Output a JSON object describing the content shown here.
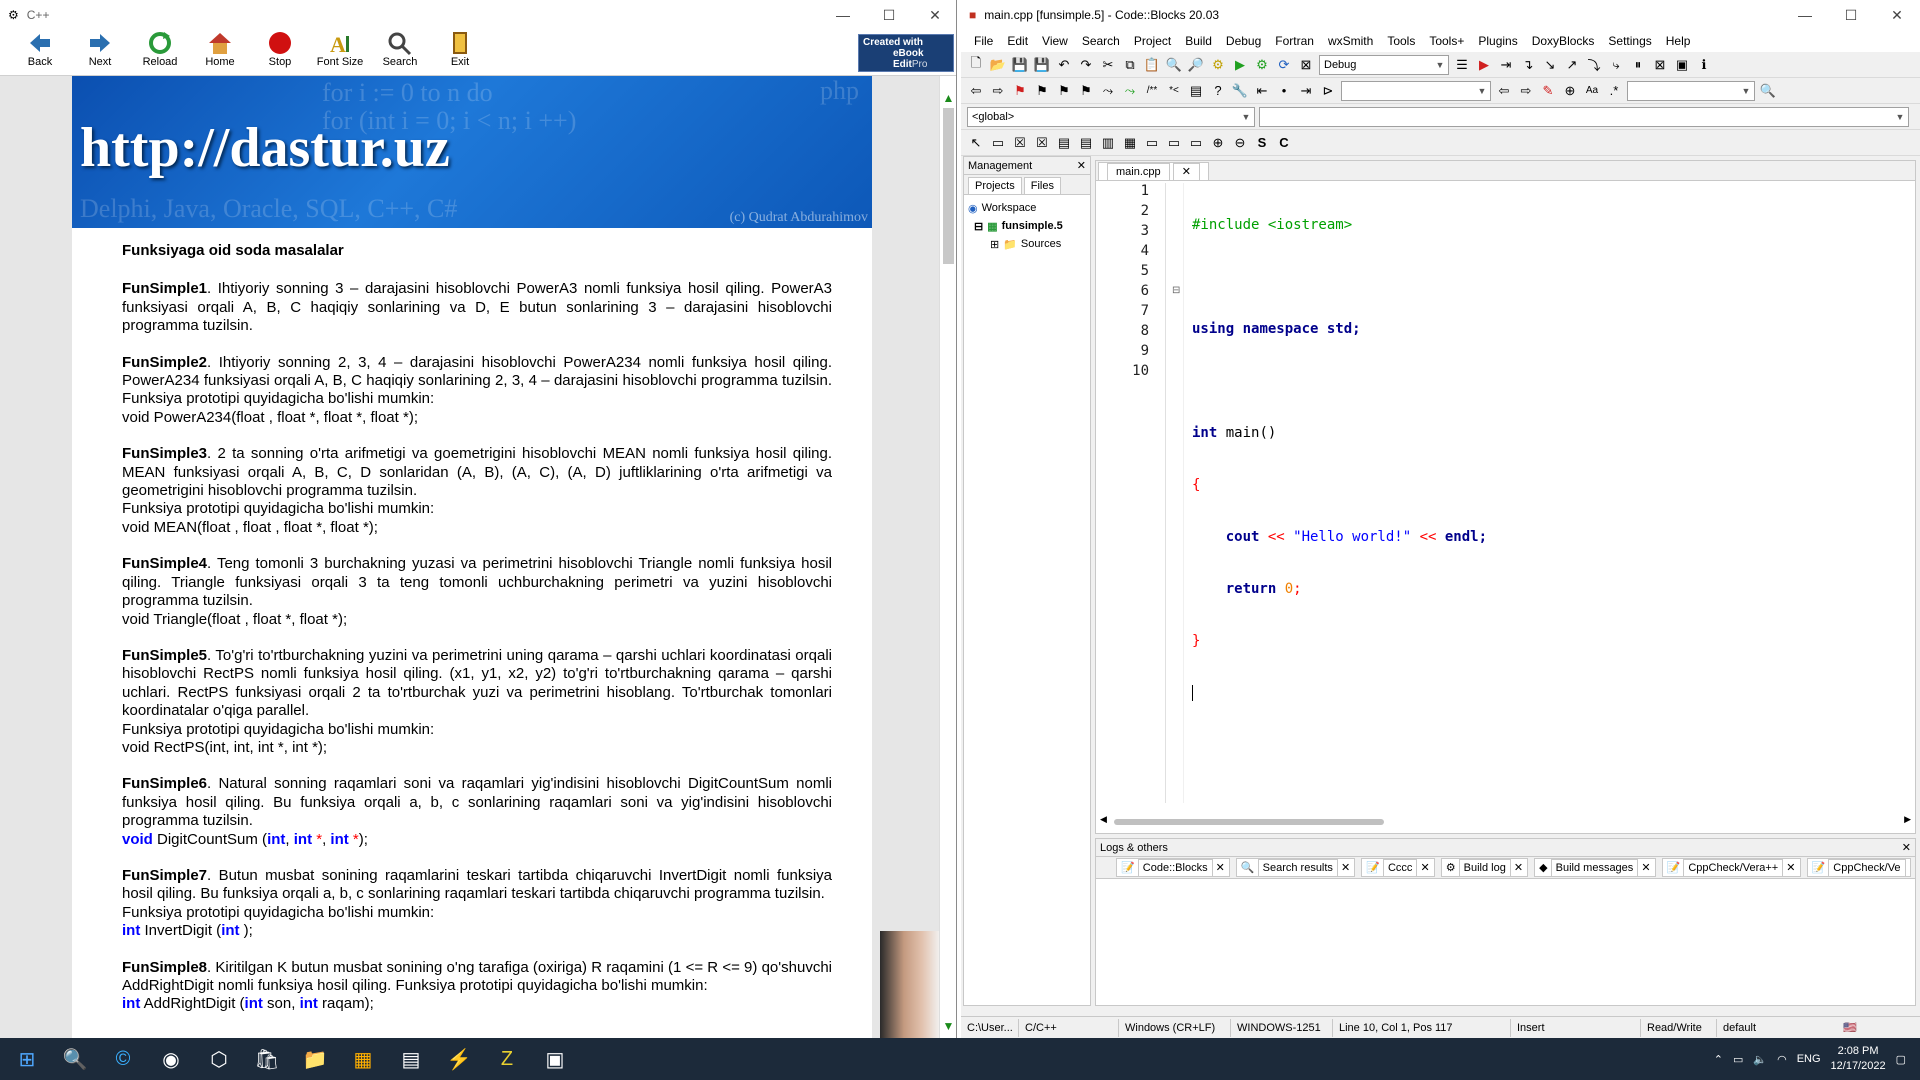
{
  "ebook": {
    "title": "C++",
    "toolbar": [
      {
        "label": "Back",
        "icon": "back-arrow-icon"
      },
      {
        "label": "Next",
        "icon": "next-arrow-icon"
      },
      {
        "label": "Reload",
        "icon": "reload-icon"
      },
      {
        "label": "Home",
        "icon": "home-icon"
      },
      {
        "label": "Stop",
        "icon": "stop-icon"
      },
      {
        "label": "Font Size",
        "icon": "font-size-icon"
      },
      {
        "label": "Search",
        "icon": "search-icon"
      },
      {
        "label": "Exit",
        "icon": "exit-icon"
      }
    ],
    "badge": {
      "line1": "Created with",
      "line2": "eBook",
      "line3": "Edit",
      "line4": "Pro"
    },
    "banner": {
      "url": "http://dastur.uz",
      "ghost1": "for  i := 0 to n do",
      "ghost2": "for  (int i = 0; i < n; i ++)",
      "ghost3": "Delphi, Java, Oracle, SQL, C++, C#",
      "ghost4": "php",
      "copyright": "(c) Qudrat Abdurahimov"
    },
    "heading": "Funksiyaga oid soda masalalar",
    "tasks": [
      {
        "name": "FunSimple1",
        "text": ". Ihtiyoriy sonning 3 – darajasini hisoblovchi PowerA3 nomli funksiya hosil qiling. PowerA3 funksiyasi orqali A, B, C haqiqiy sonlarining va D, E butun sonlarining 3 – darajasini hisoblovchi programma tuzilsin.",
        "extra": "",
        "proto": ""
      },
      {
        "name": "FunSimple2",
        "text": ". Ihtiyoriy sonning 2, 3, 4 – darajasini hisoblovchi PowerA234 nomli funksiya hosil qiling. PowerA234 funksiyasi orqali A, B, C haqiqiy sonlarining 2, 3, 4 – darajasini hisoblovchi programma tuzilsin. Funksiya prototipi quyidagicha bo'lishi mumkin:",
        "extra": "",
        "proto": "void PowerA234(float , float *, float *, float *);"
      },
      {
        "name": "FunSimple3",
        "text": ". 2 ta sonning o'rta arifmetigi va goemetrigini hisoblovchi MEAN nomli funksiya hosil qiling. MEAN funksiyasi orqali A, B, C, D sonlaridan (A, B), (A, C), (A, D) juftliklarining o'rta arifmetigi va geometrigini hisoblovchi programma tuzilsin.",
        "extra": "Funksiya prototipi quyidagicha bo'lishi mumkin:",
        "proto": "void MEAN(float , float , float *, float *);"
      },
      {
        "name": "FunSimple4",
        "text": ". Teng tomonli 3 burchakning yuzasi va perimetrini hisoblovchi Triangle nomli funksiya hosil qiling. Triangle funksiyasi orqali 3 ta teng tomonli uchburchakning perimetri va yuzini hisoblovchi programma tuzilsin.",
        "extra": "",
        "proto": "void Triangle(float ,  float *, float *);"
      },
      {
        "name": "FunSimple5",
        "text": ". To'g'ri to'rtburchakning yuzini va perimetrini uning qarama – qarshi uchlari koordinatasi orqali hisoblovchi RectPS nomli funksiya hosil qiling. (x1, y1, x2, y2) to'g'ri to'rtburchakning qarama – qarshi uchlari. RectPS funksiyasi orqali 2 ta to'rtburchak yuzi va perimetrini hisoblang. To'rtburchak tomonlari koordinatalar o'qiga parallel.",
        "extra": "Funksiya prototipi quyidagicha bo'lishi mumkin:",
        "proto": "void RectPS(int,  int,  int *, int *);"
      },
      {
        "name": "FunSimple6",
        "text": ". Natural sonning raqamlari soni va raqamlari yig'indisini hisoblovchi DigitCountSum nomli funksiya hosil qiling. Bu funksiya orqali a, b, c sonlarining raqamlari soni va yig'indisini hisoblovchi programma tuzilsin.",
        "extra": "",
        "proto": ""
      },
      {
        "name": "FunSimple7",
        "text": ". Butun musbat sonining raqamlarini teskari tartibda chiqaruvchi InvertDigit nomli funksiya hosil qiling. Bu funksiya orqali a, b, c sonlarining raqamlari teskari tartibda chiqaruvchi programma tuzilsin.",
        "extra": "Funksiya prototipi quyidagicha bo'lishi mumkin:",
        "proto": ""
      },
      {
        "name": "FunSimple8",
        "text": ". Kiritilgan K butun musbat sonining o'ng tarafiga (oxiriga)  R raqamini (1 <= R <= 9) qo'shuvchi AddRightDigit nomli funksiya hosil qiling. Funksiya prototipi quyidagicha bo'lishi mumkin:",
        "extra": "",
        "proto": ""
      }
    ],
    "proto6": {
      "kw1": "void",
      "name": " DigitCountSum (",
      "kw2": "int",
      "sep1": ",  ",
      "kw3": "int",
      "st1": " *",
      "sep2": ", ",
      "kw4": "int",
      "st2": " *",
      "end": ");"
    },
    "proto7": {
      "kw1": "int",
      "name": " InvertDigit (",
      "kw2": "int",
      "end": " );"
    },
    "proto8": {
      "kw1": "int",
      "name": " AddRightDigit (",
      "kw2": "int",
      "p1": " son, ",
      "kw3": "int",
      "end": " raqam);"
    }
  },
  "codeblocks": {
    "title": "main.cpp [funsimple.5] - Code::Blocks 20.03",
    "menu": [
      "File",
      "Edit",
      "View",
      "Search",
      "Project",
      "Build",
      "Debug",
      "Fortran",
      "wxSmith",
      "Tools",
      "Tools+",
      "Plugins",
      "DoxyBlocks",
      "Settings",
      "Help"
    ],
    "build_target": "Debug",
    "scope": "<global>",
    "management": {
      "title": "Management",
      "tab1": "Projects",
      "tab2": "Files",
      "workspace": "Workspace",
      "project": "funsimple.5",
      "sources": "Sources"
    },
    "editor_tab": "main.cpp",
    "line_numbers": [
      "1",
      "2",
      "3",
      "4",
      "5",
      "6",
      "7",
      "8",
      "9",
      "10"
    ],
    "code": {
      "l1": "#include <iostream>",
      "l3a": "using",
      "l3b": " ",
      "l3c": "namespace",
      "l3d": " std;",
      "l5a": "int",
      "l5b": " main()",
      "l6": "{",
      "l7a": "    cout ",
      "l7b": "<<",
      "l7c": " \"Hello world!\" ",
      "l7d": "<<",
      "l7e": " endl;",
      "l8a": "    return",
      "l8b": " 0",
      ";": ";",
      "l9": "}"
    },
    "logs": {
      "title": "Logs & others",
      "tabs": [
        "Code::Blocks",
        "Search results",
        "Cccc",
        "Build log",
        "Build messages",
        "CppCheck/Vera++",
        "CppCheck/Ve"
      ]
    },
    "status": [
      "C:\\User...",
      "C/C++",
      "Windows (CR+LF)",
      "WINDOWS-1251",
      "Line 10, Col 1, Pos 117",
      "Insert",
      "Read/Write",
      "default"
    ]
  },
  "taskbar": {
    "lang": "ENG",
    "time": "2:08 PM",
    "date": "12/17/2022"
  }
}
